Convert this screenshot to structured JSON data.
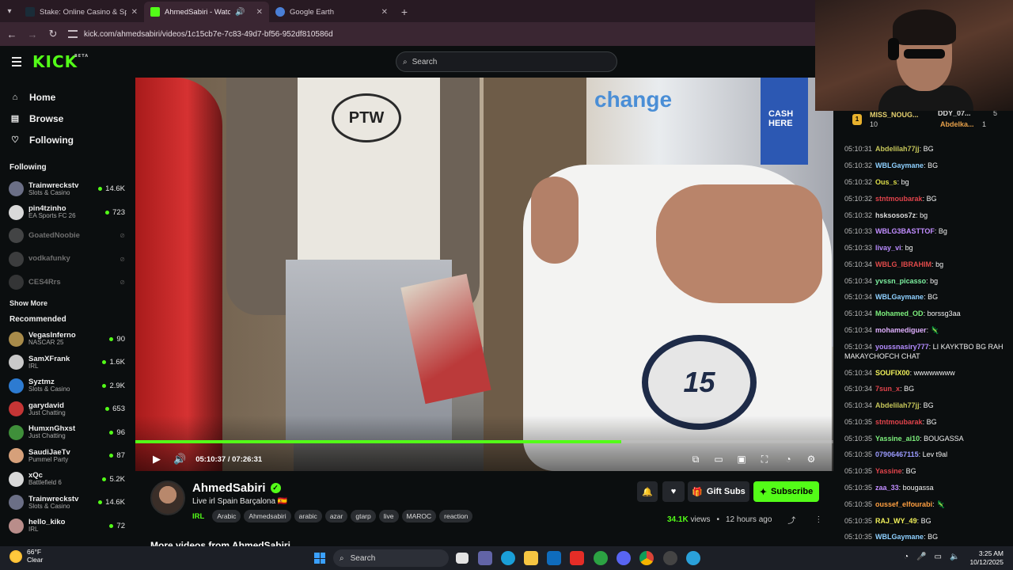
{
  "browser": {
    "tabs": [
      {
        "title": "Stake: Online Casino & Sports B",
        "favicon_color": "#1a2c38",
        "active": false
      },
      {
        "title": "AhmedSabiri - Watch the V",
        "favicon_color": "#53fc18",
        "active": true
      },
      {
        "title": "Google Earth",
        "favicon_color": "#4a7fd6",
        "active": false
      }
    ],
    "url": "kick.com/ahmedsabiri/videos/1c15cb7e-7c83-49d7-bf56-952df810586d"
  },
  "header": {
    "logo": "KICK",
    "logo_badge": "BETA",
    "search_placeholder": "Search"
  },
  "sidebar": {
    "nav": [
      {
        "label": "Home",
        "icon": "home-icon"
      },
      {
        "label": "Browse",
        "icon": "browse-icon"
      },
      {
        "label": "Following",
        "icon": "heart-icon"
      }
    ],
    "following_title": "Following",
    "following": [
      {
        "name": "Trainwreckstv",
        "category": "Slots & Casino",
        "viewers": "14.6K",
        "color": "#6b6f86",
        "live": true
      },
      {
        "name": "pin4tzinho",
        "category": "EA Sports FC 26",
        "viewers": "723",
        "color": "#d9d9d9",
        "live": true
      },
      {
        "name": "GoatedNoobie",
        "category": "",
        "viewers": "",
        "color": "#888888",
        "live": false
      },
      {
        "name": "vodkafunky",
        "category": "",
        "viewers": "",
        "color": "#777777",
        "live": false
      },
      {
        "name": "CES4Rrs",
        "category": "",
        "viewers": "",
        "color": "#666666",
        "live": false
      }
    ],
    "show_more": "Show More",
    "recommended_title": "Recommended",
    "recommended": [
      {
        "name": "VegasInferno",
        "category": "NASCAR 25",
        "viewers": "90",
        "color": "#a88b4a"
      },
      {
        "name": "SamXFrank",
        "category": "IRL",
        "viewers": "1.6K",
        "color": "#c9c9c9"
      },
      {
        "name": "Syztmz",
        "category": "Slots & Casino",
        "viewers": "2.9K",
        "color": "#2d7bd1"
      },
      {
        "name": "garydavid",
        "category": "Just Chatting",
        "viewers": "653",
        "color": "#c43535"
      },
      {
        "name": "HumxnGhxst",
        "category": "Just Chatting",
        "viewers": "96",
        "color": "#3f8f3a"
      },
      {
        "name": "SaudiJaeTv",
        "category": "Pummel Party",
        "viewers": "87",
        "color": "#d6a07a"
      },
      {
        "name": "xQc",
        "category": "Battlefield 6",
        "viewers": "5.2K",
        "color": "#d9d9d9"
      },
      {
        "name": "Trainwreckstv",
        "category": "Slots & Casino",
        "viewers": "14.6K",
        "color": "#6b6f86"
      },
      {
        "name": "hello_kiko",
        "category": "IRL",
        "viewers": "72",
        "color": "#b98d8a"
      }
    ]
  },
  "video": {
    "current_time": "05:10:37",
    "duration": "07:26:31",
    "time_display": "05:10:37 / 07:26:31",
    "progress": 0.6963,
    "sign_text": "change",
    "atm_text": "CASH HERE",
    "shirt_text": "PTW",
    "badge_text": "15"
  },
  "streamer": {
    "name": "AhmedSabiri",
    "title": "Live irl Spain Barçalona 🇪🇸",
    "category": "IRL",
    "tags": [
      "Arabic",
      "Ahmedsabiri",
      "arabic",
      "azar",
      "gtarp",
      "live",
      "MAROC",
      "reaction"
    ],
    "gift_label": "Gift Subs",
    "subscribe_label": "Subscribe",
    "views": "34.1K",
    "views_suffix": "views",
    "age": "12 hours ago",
    "more_videos": "More videos from AhmedSabiri"
  },
  "chat": {
    "gifters": [
      {
        "rank": "1",
        "name": "MISS_NOUG...",
        "count": "10"
      },
      {
        "rank": "",
        "name": "DDY_07...",
        "count": "5"
      },
      {
        "rank": "",
        "name": "Abdelka...",
        "count": "1"
      }
    ],
    "messages": [
      {
        "ts": "05:10:31",
        "user": "Abdelilah77jj",
        "color": "#c6c65a",
        "text": "BG"
      },
      {
        "ts": "05:10:32",
        "user": "WBLGaymane",
        "color": "#8ed0ff",
        "text": "BG"
      },
      {
        "ts": "05:10:32",
        "user": "Ous_s",
        "color": "#dede4a",
        "text": "bg"
      },
      {
        "ts": "05:10:32",
        "user": "stntmoubarak",
        "color": "#e0434b",
        "text": "BG"
      },
      {
        "ts": "05:10:32",
        "user": "hsksosos7z",
        "color": "#dcdcdc",
        "text": "bg"
      },
      {
        "ts": "05:10:33",
        "user": "WBLG3BASTTOF",
        "color": "#c18dff",
        "text": "Bg"
      },
      {
        "ts": "05:10:33",
        "user": "livay_vi",
        "color": "#b98cff",
        "text": "bg"
      },
      {
        "ts": "05:10:34",
        "user": "WBLG_IBRAHIM",
        "color": "#e04a4a",
        "text": "bg"
      },
      {
        "ts": "05:10:34",
        "user": "yvssn_picasso",
        "color": "#7df0a0",
        "text": "bg"
      },
      {
        "ts": "05:10:34",
        "user": "WBLGaymane",
        "color": "#8ed0ff",
        "text": "BG"
      },
      {
        "ts": "05:10:34",
        "user": "Mohamed_OD",
        "color": "#7df07d",
        "text": "borssg3aa"
      },
      {
        "ts": "05:10:34",
        "user": "mohamediguer",
        "color": "#e0b0ff",
        "text": "🦎"
      },
      {
        "ts": "05:10:34",
        "user": "youssnasiry777",
        "color": "#b48cff",
        "text": "LI KAYKTBO BG RAH MAKAYCHOFCH CHAT"
      },
      {
        "ts": "05:10:34",
        "user": "SOUFIX00",
        "color": "#f0f05a",
        "text": "wwwwwwww"
      },
      {
        "ts": "05:10:34",
        "user": "7sun_x",
        "color": "#e0434b",
        "text": "BG"
      },
      {
        "ts": "05:10:34",
        "user": "Abdelilah77jj",
        "color": "#c6c65a",
        "text": "BG"
      },
      {
        "ts": "05:10:35",
        "user": "stntmoubarak",
        "color": "#e0434b",
        "text": "BG"
      },
      {
        "ts": "05:10:35",
        "user": "Yassine_ai10",
        "color": "#7df07d",
        "text": "BOUGASSA"
      },
      {
        "ts": "05:10:35",
        "user": "07906467115",
        "color": "#9b9bff",
        "text": "Lev t9al"
      },
      {
        "ts": "05:10:35",
        "user": "Yassine",
        "color": "#e0434b",
        "text": "BG"
      },
      {
        "ts": "05:10:35",
        "user": "zaa_33",
        "color": "#c18dff",
        "text": "bougassa"
      },
      {
        "ts": "05:10:35",
        "user": "oussef_elfourabi",
        "color": "#ff9f40",
        "text": "🦎"
      },
      {
        "ts": "05:10:35",
        "user": "RAJ_WY_49",
        "color": "#f0f05a",
        "text": "BG"
      },
      {
        "ts": "05:10:35",
        "user": "WBLGaymane",
        "color": "#8ed0ff",
        "text": "BG"
      }
    ]
  },
  "taskbar": {
    "temp": "66°F",
    "condition": "Clear",
    "search": "Search",
    "time": "3:25 AM",
    "date": "10/12/2025"
  }
}
